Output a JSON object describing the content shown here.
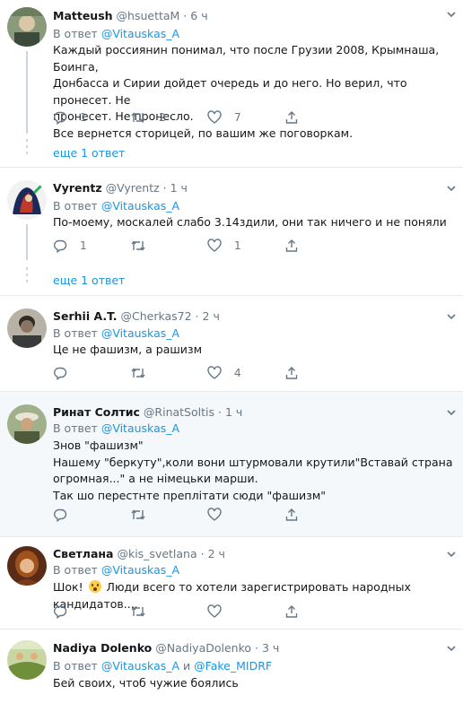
{
  "colors": {
    "link": "#1b95e0",
    "muted": "#657786",
    "text": "#14171a",
    "highlight_bg": "#f5f8fa",
    "divider": "#e6ecf0"
  },
  "reply_prefix": "В ответ",
  "tweets": [
    {
      "name": "Matteush",
      "handle": "@hsuettaM",
      "dot": "·",
      "time": "6 ч",
      "reply_to": "@Vitauskas_A",
      "lines": [
        "Каждый россиянин понимал, что после Грузии 2008, Крымнаша, Боинга,",
        "Донбасса и Сирии дойдет очередь и до него. Но верил, что пронесет. Не",
        "пронесет. Не пронесло.",
        "Все вернется сторицей, по вашим же поговоркам."
      ],
      "replies": "1",
      "retweets": "2",
      "likes": "7",
      "more_replies": "еще 1 ответ"
    },
    {
      "name": "Vyrentz",
      "handle": "@Vyrentz",
      "dot": "·",
      "time": "1 ч",
      "reply_to": "@Vitauskas_A",
      "lines": [
        "По-моему, москалей слабо 3.14здили, они так ничего и не поняли"
      ],
      "replies": "1",
      "retweets": "",
      "likes": "1",
      "more_replies": "еще 1 ответ"
    },
    {
      "name": "Serhii A.T.",
      "handle": "@Cherkas72",
      "dot": "·",
      "time": "2 ч",
      "reply_to": "@Vitauskas_A",
      "lines": [
        "Це не фашизм, а рашизм"
      ],
      "replies": "",
      "retweets": "",
      "likes": "4"
    },
    {
      "name": "Ринат Солтис",
      "handle": "@RinatSoltis",
      "dot": "·",
      "time": "1 ч",
      "reply_to": "@Vitauskas_A",
      "lines": [
        "Знов \"фашизм\"",
        "Нашему \"беркуту\",коли вони штурмовали крутили\"Вставай страна",
        "огромная...\" а не німецьки марши.",
        "Так шо перестнте преплітати сюди \"фашизм\""
      ],
      "replies": "",
      "retweets": "",
      "likes": ""
    },
    {
      "name": "Светлана",
      "handle": "@kis_svetlana",
      "dot": "·",
      "time": "2 ч",
      "reply_to": "@Vitauskas_A",
      "text_before_emoji": "Шок!",
      "text_after_emoji": "Люди всего то хотели зарегистрировать народных кандидатов....",
      "replies": "",
      "retweets": "",
      "likes": ""
    },
    {
      "name": "Nadiya Dolenko",
      "handle": "@NadiyaDolenko",
      "dot": "·",
      "time": "3 ч",
      "reply_to": "@Vitauskas_A",
      "reply_and": "и",
      "reply_to_2": "@Fake_MIDRF",
      "lines": [
        "Бей своих, чтоб чужие боялись"
      ]
    }
  ]
}
